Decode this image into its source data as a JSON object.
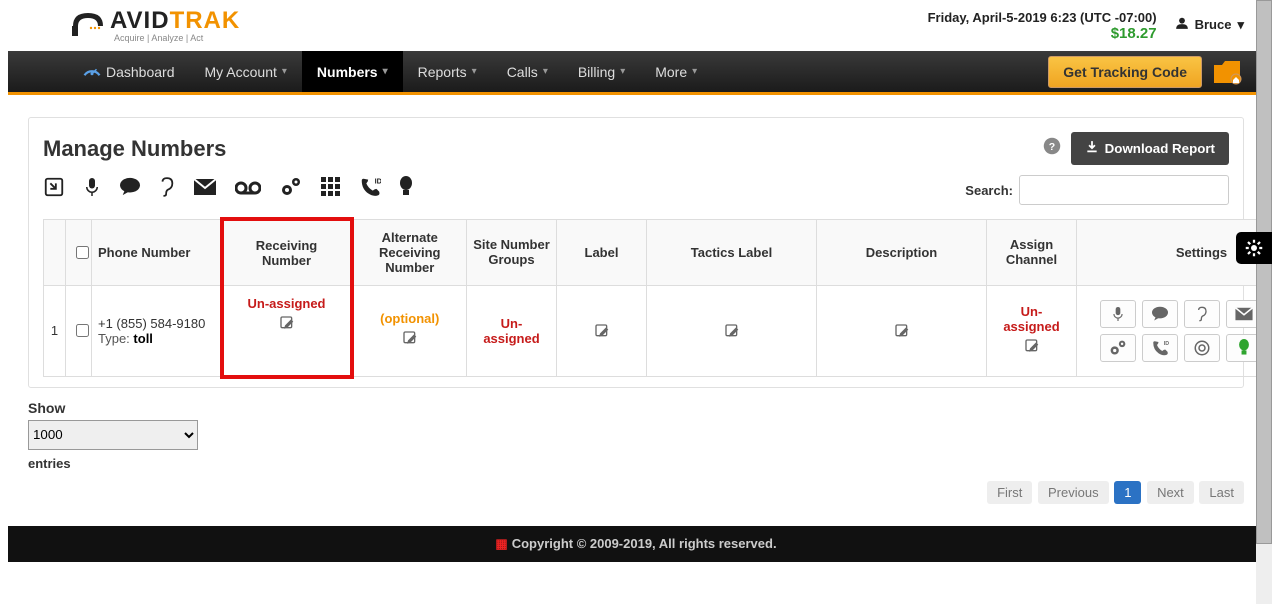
{
  "header": {
    "brand_dark": "AVID",
    "brand_orange": "TRAK",
    "tagline": "Acquire | Analyze | Act",
    "datetime": "Friday, April-5-2019 6:23 (UTC -07:00)",
    "balance": "$18.27",
    "username": "Bruce"
  },
  "nav": {
    "dashboard": "Dashboard",
    "my_account": "My Account",
    "numbers": "Numbers",
    "reports": "Reports",
    "calls": "Calls",
    "billing": "Billing",
    "more": "More",
    "tracking_btn": "Get Tracking Code"
  },
  "panel": {
    "title": "Manage Numbers",
    "download": "Download Report",
    "search_label": "Search:"
  },
  "table": {
    "cols": {
      "phone": "Phone Number",
      "recv": "Receiving Number",
      "alt": "Alternate Receiving Number",
      "site": "Site Number Groups",
      "label": "Label",
      "tactics": "Tactics Label",
      "desc": "Description",
      "chan": "Assign Channel",
      "settings": "Settings"
    },
    "row": {
      "idx": "1",
      "phone": "+1 (855) 584-9180",
      "type_label": "Type:",
      "type_value": "toll",
      "recv": "Un-assigned",
      "alt": "(optional)",
      "site": "Un-assigned",
      "chan": "Un-assigned"
    }
  },
  "entries": {
    "show": "Show",
    "value": "1000",
    "after": "entries"
  },
  "pagination": {
    "first": "First",
    "prev": "Previous",
    "p1": "1",
    "next": "Next",
    "last": "Last"
  },
  "footer": "Copyright © 2009-2019, All rights reserved."
}
